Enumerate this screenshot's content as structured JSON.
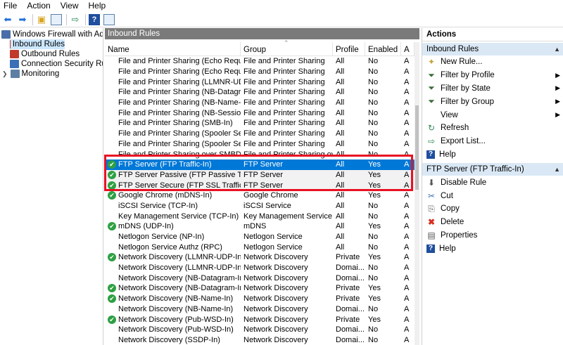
{
  "menu": {
    "file": "File",
    "action": "Action",
    "view": "View",
    "help": "Help"
  },
  "tree": {
    "root": "Windows Firewall with Advance",
    "inbound": "Inbound Rules",
    "outbound": "Outbound Rules",
    "connection": "Connection Security Rules",
    "monitoring": "Monitoring"
  },
  "middle": {
    "header": "Inbound Rules",
    "columns": {
      "name": "Name",
      "group": "Group",
      "profile": "Profile",
      "enabled": "Enabled",
      "action": "A"
    },
    "rows": [
      {
        "name": "File and Printer Sharing (Echo Request - I...",
        "group": "File and Printer Sharing",
        "profile": "All",
        "enabled": "No",
        "action": "A"
      },
      {
        "name": "File and Printer Sharing (Echo Request - I...",
        "group": "File and Printer Sharing",
        "profile": "All",
        "enabled": "No",
        "action": "A"
      },
      {
        "name": "File and Printer Sharing (LLMNR-UDP-In)",
        "group": "File and Printer Sharing",
        "profile": "All",
        "enabled": "No",
        "action": "A"
      },
      {
        "name": "File and Printer Sharing (NB-Datagram-In)",
        "group": "File and Printer Sharing",
        "profile": "All",
        "enabled": "No",
        "action": "A"
      },
      {
        "name": "File and Printer Sharing (NB-Name-In)",
        "group": "File and Printer Sharing",
        "profile": "All",
        "enabled": "No",
        "action": "A"
      },
      {
        "name": "File and Printer Sharing (NB-Session-In)",
        "group": "File and Printer Sharing",
        "profile": "All",
        "enabled": "No",
        "action": "A"
      },
      {
        "name": "File and Printer Sharing (SMB-In)",
        "group": "File and Printer Sharing",
        "profile": "All",
        "enabled": "No",
        "action": "A"
      },
      {
        "name": "File and Printer Sharing (Spooler Service -...",
        "group": "File and Printer Sharing",
        "profile": "All",
        "enabled": "No",
        "action": "A"
      },
      {
        "name": "File and Printer Sharing (Spooler Service -...",
        "group": "File and Printer Sharing",
        "profile": "All",
        "enabled": "No",
        "action": "A"
      },
      {
        "name": "File and Printer Sharing over SMBDirect (iW...",
        "group": "File and Printer Sharing over ...",
        "profile": "All",
        "enabled": "No",
        "action": "A"
      },
      {
        "name": "FTP Server (FTP Traffic-In)",
        "group": "FTP Server",
        "profile": "All",
        "enabled": "Yes",
        "action": "A",
        "state": "selected",
        "icon": true
      },
      {
        "name": "FTP Server Passive (FTP Passive Traffic-In)",
        "group": "FTP Server",
        "profile": "All",
        "enabled": "Yes",
        "action": "A",
        "state": "hl",
        "icon": true
      },
      {
        "name": "FTP Server Secure (FTP SSL Traffic-In)",
        "group": "FTP Server",
        "profile": "All",
        "enabled": "Yes",
        "action": "A",
        "state": "hl",
        "icon": true
      },
      {
        "name": "Google Chrome (mDNS-In)",
        "group": "Google Chrome",
        "profile": "All",
        "enabled": "Yes",
        "action": "A",
        "icon": true
      },
      {
        "name": "iSCSI Service (TCP-In)",
        "group": "iSCSI Service",
        "profile": "All",
        "enabled": "No",
        "action": "A"
      },
      {
        "name": "Key Management Service (TCP-In)",
        "group": "Key Management Service",
        "profile": "All",
        "enabled": "No",
        "action": "A"
      },
      {
        "name": "mDNS (UDP-In)",
        "group": "mDNS",
        "profile": "All",
        "enabled": "Yes",
        "action": "A",
        "icon": true
      },
      {
        "name": "Netlogon Service (NP-In)",
        "group": "Netlogon Service",
        "profile": "All",
        "enabled": "No",
        "action": "A"
      },
      {
        "name": "Netlogon Service Authz (RPC)",
        "group": "Netlogon Service",
        "profile": "All",
        "enabled": "No",
        "action": "A"
      },
      {
        "name": "Network Discovery (LLMNR-UDP-In)",
        "group": "Network Discovery",
        "profile": "Private",
        "enabled": "Yes",
        "action": "A",
        "icon": true
      },
      {
        "name": "Network Discovery (LLMNR-UDP-In)",
        "group": "Network Discovery",
        "profile": "Domai...",
        "enabled": "No",
        "action": "A"
      },
      {
        "name": "Network Discovery (NB-Datagram-In)",
        "group": "Network Discovery",
        "profile": "Domai...",
        "enabled": "No",
        "action": "A"
      },
      {
        "name": "Network Discovery (NB-Datagram-In)",
        "group": "Network Discovery",
        "profile": "Private",
        "enabled": "Yes",
        "action": "A",
        "icon": true
      },
      {
        "name": "Network Discovery (NB-Name-In)",
        "group": "Network Discovery",
        "profile": "Private",
        "enabled": "Yes",
        "action": "A",
        "icon": true
      },
      {
        "name": "Network Discovery (NB-Name-In)",
        "group": "Network Discovery",
        "profile": "Domai...",
        "enabled": "No",
        "action": "A"
      },
      {
        "name": "Network Discovery (Pub-WSD-In)",
        "group": "Network Discovery",
        "profile": "Private",
        "enabled": "Yes",
        "action": "A",
        "icon": true
      },
      {
        "name": "Network Discovery (Pub-WSD-In)",
        "group": "Network Discovery",
        "profile": "Domai...",
        "enabled": "No",
        "action": "A"
      },
      {
        "name": "Network Discovery (SSDP-In)",
        "group": "Network Discovery",
        "profile": "Domai...",
        "enabled": "No",
        "action": "A"
      }
    ]
  },
  "actions": {
    "title": "Actions",
    "section1": "Inbound Rules",
    "new_rule": "New Rule...",
    "filter_profile": "Filter by Profile",
    "filter_state": "Filter by State",
    "filter_group": "Filter by Group",
    "view": "View",
    "refresh": "Refresh",
    "export": "Export List...",
    "help1": "Help",
    "section2": "FTP Server (FTP Traffic-In)",
    "disable": "Disable Rule",
    "cut": "Cut",
    "copy": "Copy",
    "delete": "Delete",
    "properties": "Properties",
    "help2": "Help"
  },
  "colors": {
    "selection": "#0078d7",
    "highlight_box": "#e81123",
    "enabled_icon": "#2ea043",
    "pane_header": "#7a7a7a",
    "section_bg": "#dae8f5"
  }
}
